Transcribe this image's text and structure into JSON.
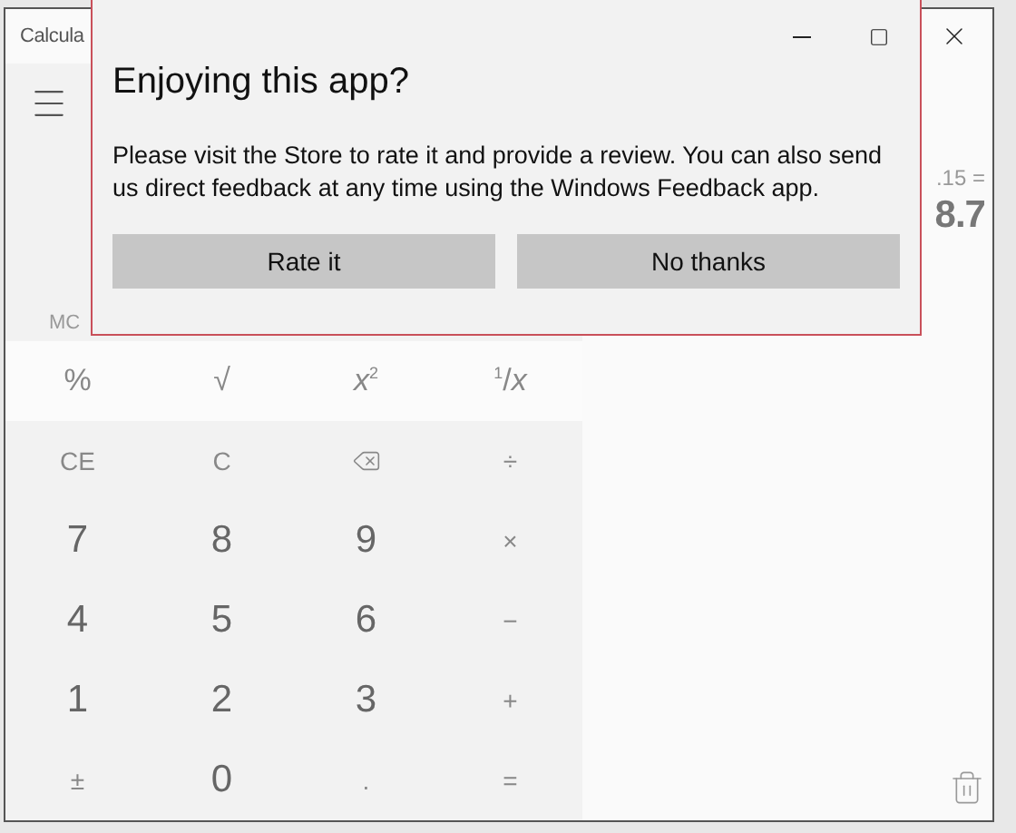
{
  "window": {
    "title": "Calcula"
  },
  "memory": {
    "label": "MC",
    "disabled": true
  },
  "history": {
    "expression": ".15 =",
    "result": "8.7"
  },
  "keys": [
    {
      "label": "%",
      "kind": "scientific"
    },
    {
      "label": "√",
      "kind": "scientific"
    },
    {
      "label": "*x*$^{2}$",
      "kind": "scientific"
    },
    {
      "label": "$^{1}$/*x*",
      "kind": "scientific"
    },
    {
      "label": "CE",
      "kind": "operator"
    },
    {
      "label": "C",
      "kind": "operator"
    },
    {
      "kind": "backspace"
    },
    {
      "label": "÷",
      "kind": "operator"
    },
    {
      "label": "7",
      "kind": "digit"
    },
    {
      "label": "8",
      "kind": "digit"
    },
    {
      "label": "9",
      "kind": "digit"
    },
    {
      "label": "×",
      "kind": "operator"
    },
    {
      "label": "4",
      "kind": "digit"
    },
    {
      "label": "5",
      "kind": "digit"
    },
    {
      "label": "6",
      "kind": "digit"
    },
    {
      "label": "−",
      "kind": "operator"
    },
    {
      "label": "1",
      "kind": "digit"
    },
    {
      "label": "2",
      "kind": "digit"
    },
    {
      "label": "3",
      "kind": "digit"
    },
    {
      "label": "+",
      "kind": "operator"
    },
    {
      "label": "±",
      "kind": "operator"
    },
    {
      "label": "0",
      "kind": "digit"
    },
    {
      "label": ".",
      "kind": "operator"
    },
    {
      "label": "=",
      "kind": "operator"
    }
  ],
  "dialog": {
    "title": "Enjoying this app?",
    "message": "Please visit the Store to rate it and provide a review. You can also send us direct feedback at any time using the Windows Feedback app.",
    "buttons": [
      "Rate it",
      "No thanks"
    ]
  }
}
